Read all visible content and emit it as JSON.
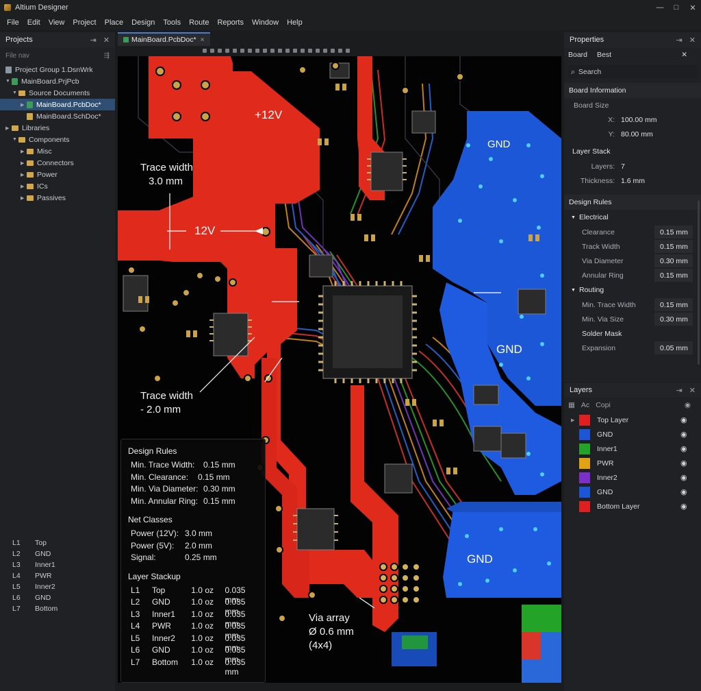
{
  "app": {
    "title": "Altium Designer"
  },
  "window_controls": {
    "minimize": "—",
    "maximize": "□",
    "close": "✕"
  },
  "menu": [
    "File",
    "Edit",
    "View",
    "Project",
    "Place",
    "Design",
    "Tools",
    "Route",
    "Reports",
    "Window",
    "Help"
  ],
  "projects_panel": {
    "title": "Projects",
    "filter_placeholder": "File nav",
    "tree": {
      "group": "Project Group 1.DsnWrk",
      "project": "MainBoard.PrjPcb",
      "source_documents": "Source Documents",
      "pcb_doc": "MainBoard.PcbDoc*",
      "sch_doc": "MainBoard.SchDoc*",
      "libraries": "Libraries",
      "components": "Components",
      "misc": "Misc",
      "connectors": "Connectors",
      "power": "Power",
      "ics": "ICs",
      "passives": "Passives"
    },
    "layer_list": [
      {
        "id": "L1",
        "name": "Top"
      },
      {
        "id": "L2",
        "name": "GND"
      },
      {
        "id": "L3",
        "name": "Inner1"
      },
      {
        "id": "L4",
        "name": "PWR"
      },
      {
        "id": "L5",
        "name": "Inner2"
      },
      {
        "id": "L6",
        "name": "GND"
      },
      {
        "id": "L7",
        "name": "Bottom"
      }
    ]
  },
  "document_tab": {
    "label": "MainBoard.PcbDoc*"
  },
  "canvas": {
    "plane_12v": "+12V",
    "trace_label_12v": "12V",
    "plane_gnd_top": "GND",
    "plane_gnd_mid": "GND",
    "plane_gnd_bottom": "GND",
    "callout_trace_3": {
      "line1": "Trace width",
      "line2": "3.0 mm"
    },
    "callout_trace_2": {
      "line1": "Trace width",
      "line2": "- 2.0 mm"
    },
    "callout_via": {
      "line1": "Via array",
      "line2": "Ø 0.6 mm",
      "line3": "(4x4)"
    },
    "info": {
      "design_rules_title": "Design Rules",
      "rules": [
        {
          "label": "Min.  Trace Width:",
          "value": "0.15 mm"
        },
        {
          "label": "Min.  Clearance:",
          "value": "0.15 mm"
        },
        {
          "label": "Min.  Via Diameter:",
          "value": "0.30 mm"
        },
        {
          "label": "Min.  Annular Ring:",
          "value": "0.15 mm"
        }
      ],
      "net_classes_title": "Net Classes",
      "net_classes": [
        {
          "label": "Power (12V):",
          "value": "3.0 mm"
        },
        {
          "label": "Power (5V):",
          "value": "2.0 mm"
        },
        {
          "label": "Signal:",
          "value": "0.25 mm"
        }
      ],
      "stackup_title": "Layer Stackup",
      "stackup": [
        {
          "id": "L1",
          "name": "Top",
          "weight": "1.0 oz",
          "thickness": "0.035 mm"
        },
        {
          "id": "L2",
          "name": "GND",
          "weight": "1.0 oz",
          "thickness": "0.035 mm"
        },
        {
          "id": "L3",
          "name": "Inner1",
          "weight": "1.0 oz",
          "thickness": "0.035 mm"
        },
        {
          "id": "L4",
          "name": "PWR",
          "weight": "1.0 oz",
          "thickness": "0.035 mm"
        },
        {
          "id": "L5",
          "name": "Inner2",
          "weight": "1.0 oz",
          "thickness": "0.035 mm"
        },
        {
          "id": "L6",
          "name": "GND",
          "weight": "1.0 oz",
          "thickness": "0.035 mm"
        },
        {
          "id": "L7",
          "name": "Bottom",
          "weight": "1.0 oz",
          "thickness": "0.035 mm"
        }
      ]
    }
  },
  "properties": {
    "title": "Properties",
    "tabs": [
      "Board",
      "Best"
    ],
    "search_placeholder": "Search",
    "board_info_title": "Board Information",
    "board_size_label": "Board Size",
    "x_label": "X:",
    "x_value": "100.00 mm",
    "y_label": "Y:",
    "y_value": "80.00 mm",
    "layer_stack_title": "Layer Stack",
    "layers_label": "Layers:",
    "layers_value": "7",
    "thickness_label": "Thickness:",
    "thickness_value": "1.6 mm",
    "design_rules_title": "Design Rules",
    "electrical_title": "Electrical",
    "electrical": [
      {
        "label": "Clearance",
        "value": "0.15 mm"
      },
      {
        "label": "Track Width",
        "value": "0.15 mm"
      },
      {
        "label": "Via Diameter",
        "value": "0.30 mm"
      },
      {
        "label": "Annular Ring",
        "value": "0.15 mm"
      }
    ],
    "routing_title": "Routing",
    "routing": [
      {
        "label": "Min. Trace Width",
        "value": "0.15 mm"
      },
      {
        "label": "Min. Via Size",
        "value": "0.30 mm"
      }
    ],
    "solder_mask_label": "Solder Mask",
    "expansion_label": "Expansion",
    "expansion_value": "0.05 mm"
  },
  "layers_panel": {
    "title": "Layers",
    "tabs": [
      "Ac",
      "Copi"
    ],
    "layers": [
      {
        "name": "Top Layer",
        "color": "#e02020"
      },
      {
        "name": "GND",
        "color": "#1c56d6"
      },
      {
        "name": "Inner1",
        "color": "#23a327"
      },
      {
        "name": "PWR",
        "color": "#e3a114"
      },
      {
        "name": "Inner2",
        "color": "#7c2fc9"
      },
      {
        "name": "GND",
        "color": "#1c56d6"
      },
      {
        "name": "Bottom Layer",
        "color": "#e02020"
      }
    ]
  }
}
